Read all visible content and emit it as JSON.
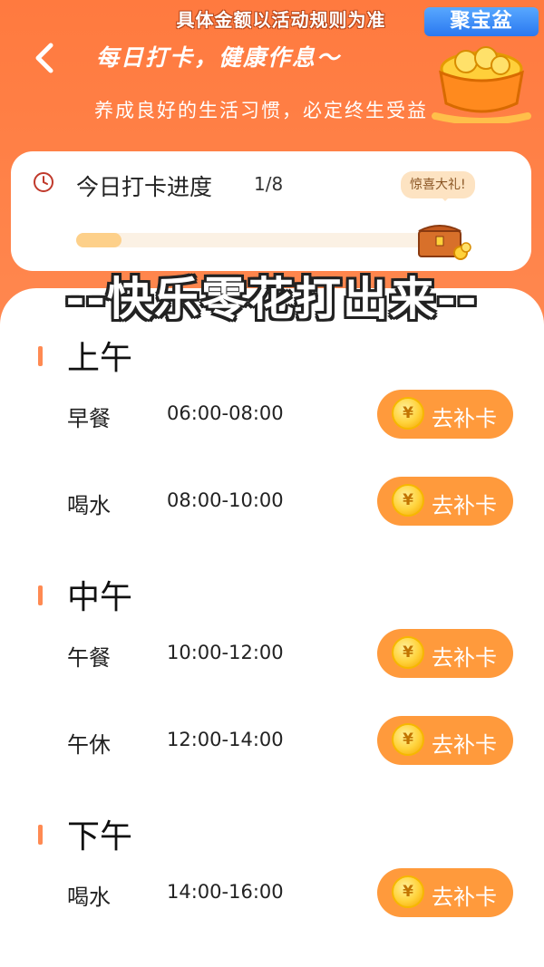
{
  "header": {
    "disclaimer": "具体金额以活动规则为准",
    "title": "每日打卡，健康作息～",
    "subtitle": "养成良好的生活习惯，必定终生受益",
    "promo_label": "聚宝盆"
  },
  "progress": {
    "label": "今日打卡进度",
    "count": "1/8",
    "completed": 1,
    "total": 8,
    "gift_bubble": "惊喜大礼!"
  },
  "overlay_caption": "--快乐零花打出来--",
  "sections": [
    {
      "title": "上午",
      "items": [
        {
          "name": "早餐",
          "time": "06:00-08:00",
          "button": "去补卡"
        },
        {
          "name": "喝水",
          "time": "08:00-10:00",
          "button": "去补卡"
        }
      ]
    },
    {
      "title": "中午",
      "items": [
        {
          "name": "午餐",
          "time": "10:00-12:00",
          "button": "去补卡"
        },
        {
          "name": "午休",
          "time": "12:00-14:00",
          "button": "去补卡"
        }
      ]
    },
    {
      "title": "下午",
      "items": [
        {
          "name": "喝水",
          "time": "14:00-16:00",
          "button": "去补卡"
        }
      ]
    }
  ],
  "coin_symbol": "¥",
  "colors": {
    "accent": "#ff8a52",
    "button": "#ff9a3c",
    "coin": "#ffd23a"
  }
}
